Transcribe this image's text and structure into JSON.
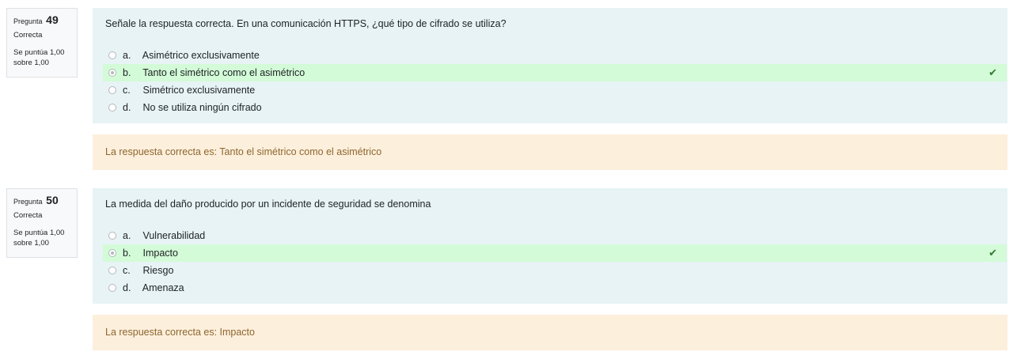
{
  "questions": [
    {
      "label": "Pregunta",
      "number": "49",
      "state": "Correcta",
      "grade": "Se puntúa 1,00 sobre 1,00",
      "text": "Señale la respuesta correcta. En una comunicación HTTPS, ¿qué tipo de cifrado se utiliza?",
      "answers": [
        {
          "letter": "a.",
          "text": "Asimétrico exclusivamente"
        },
        {
          "letter": "b.",
          "text": "Tanto el simétrico como el asimétrico"
        },
        {
          "letter": "c.",
          "text": "Simétrico exclusivamente"
        },
        {
          "letter": "d.",
          "text": "No se utiliza ningún cifrado"
        }
      ],
      "selected": "b.",
      "feedback": "La respuesta correcta es: Tanto el simétrico como el asimétrico"
    },
    {
      "label": "Pregunta",
      "number": "50",
      "state": "Correcta",
      "grade": "Se puntúa 1,00 sobre 1,00",
      "text": "La medida del daño producido por un incidente de seguridad se denomina",
      "answers": [
        {
          "letter": "a.",
          "text": "Vulnerabilidad"
        },
        {
          "letter": "b.",
          "text": "Impacto"
        },
        {
          "letter": "c.",
          "text": "Riesgo"
        },
        {
          "letter": "d.",
          "text": "Amenaza"
        }
      ],
      "selected": "b.",
      "feedback": "La respuesta correcta es: Impacto"
    }
  ],
  "icons": {
    "correct": "check-icon",
    "correct_color": "#357a32"
  },
  "colors": {
    "formulation_bg": "#e7f3f5",
    "correct_bg": "#d3fbd7",
    "feedback_bg": "#fcefdc",
    "feedback_text": "#8e662e"
  }
}
